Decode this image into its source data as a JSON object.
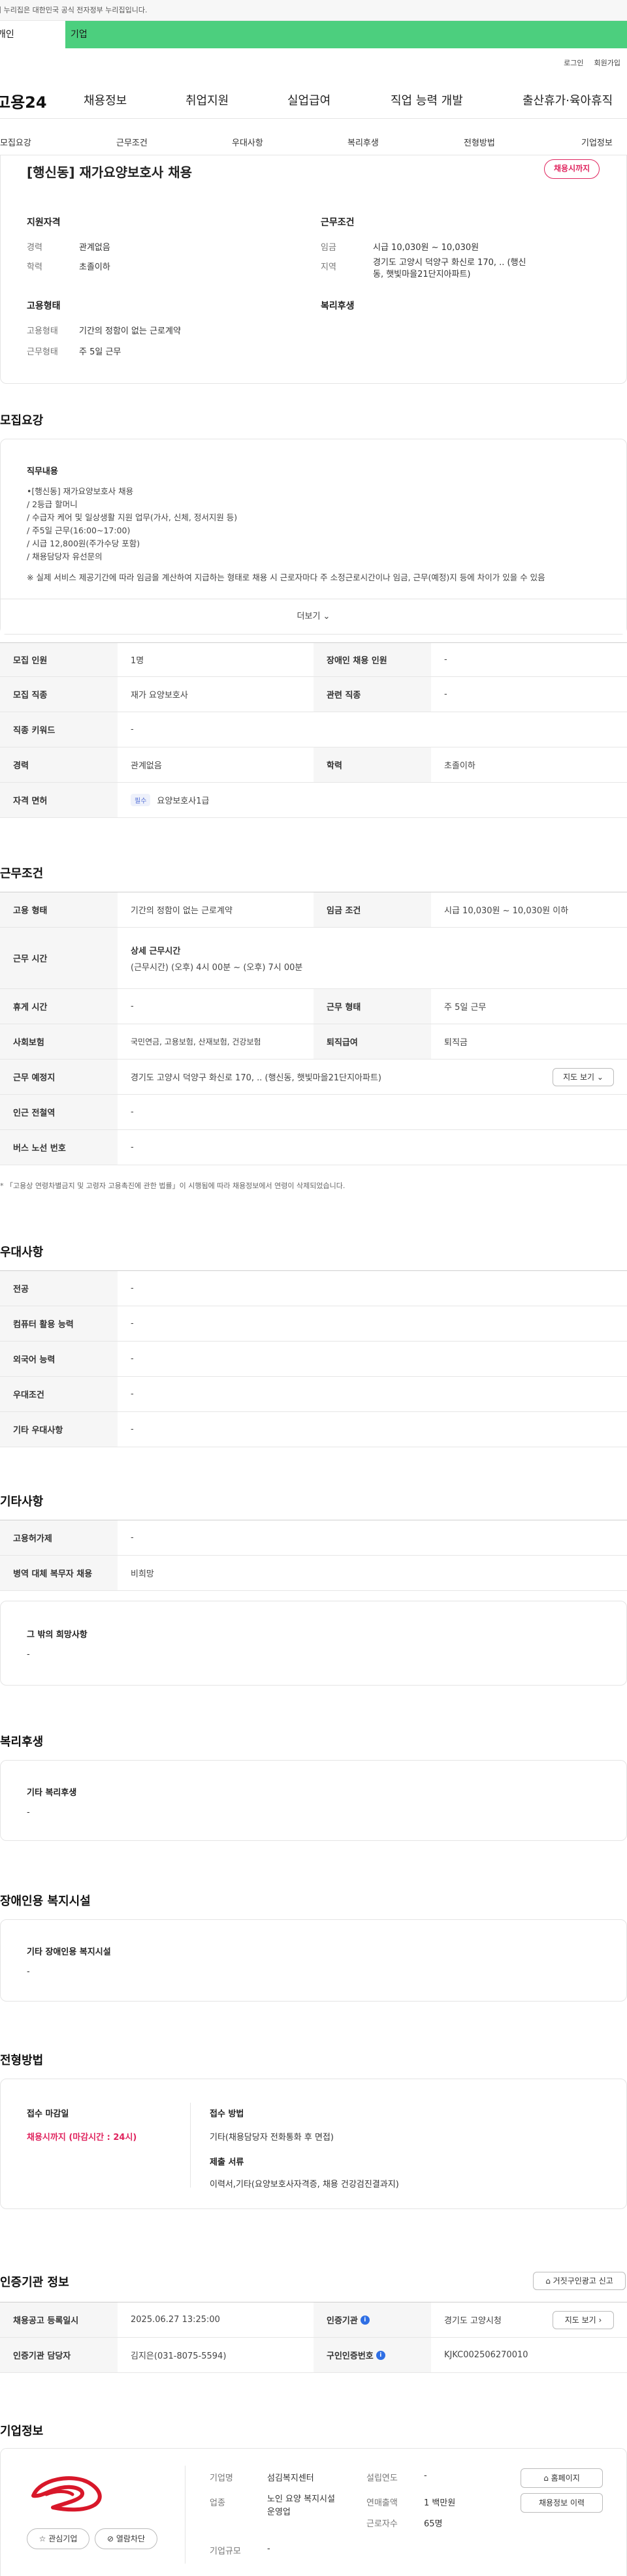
{
  "gov_banner": "이 누리집은 대한민국 공식 전자정부 누리집입니다.",
  "tabs": [
    "개인",
    "기업"
  ],
  "util": [
    "로그인",
    "회원가입"
  ],
  "logo": "고용24",
  "gnb": [
    "채용정보",
    "취업지원",
    "실업급여",
    "직업 능력 개발",
    "출산휴가·육아휴직"
  ],
  "subnav": [
    "모집요강",
    "근무조건",
    "우대사항",
    "복리후생",
    "전형방법",
    "기업정보"
  ],
  "job": {
    "title": "[행신동] 재가요양보호사 채용",
    "status": "채용시까지",
    "support_title": "지원자격",
    "support": [
      [
        "경력",
        "관계없음"
      ],
      [
        "학력",
        "초졸이하"
      ]
    ],
    "cond_title": "근무조건",
    "cond": [
      [
        "임금",
        "시급 10,030원 ~ 10,030원"
      ],
      [
        "지역",
        "경기도 고양시 덕양구 화신로 170, .. (행신동, 햇빛마을21단지아파트)"
      ]
    ],
    "emp_title": "고용형태",
    "emp": [
      [
        "고용형태",
        "기간의 정함이 없는 근로계약"
      ],
      [
        "근무형태",
        "주 5일 근무"
      ]
    ],
    "welfare_title": "복리후생"
  },
  "recruit": {
    "title": "모집요강",
    "duty_label": "직무내용",
    "duty_lines": [
      "•[행신동] 재가요양보호사 채용",
      "/ 2등급 할머니",
      "/ 수급자 케어 및 일상생활 지원 업무(가사, 신체, 정서지원 등)",
      "/ 주5일 근무(16:00~17:00)",
      "/ 시급 12,800원(주가수당 포함)",
      "/ 채용담당자 유선문의",
      "",
      "※ 실제 서비스 제공기간에 따라 임금을 계산하여 지급하는 형태로 채용 시 근로자마다 주 소정근로시간이나 임금, 근무(예정)지 등에 차이가 있을 수 있음"
    ],
    "more": "더보기",
    "rows": [
      [
        "모집 인원",
        "1명",
        "장애인 채용 인원",
        "-"
      ],
      [
        "모집 직종",
        "재가 요양보호사",
        "관련 직종",
        "-"
      ],
      [
        "직종 키워드",
        "-"
      ],
      [
        "경력",
        "관계없음",
        "학력",
        "초졸이하"
      ],
      [
        "자격 면허",
        "요양보호사1급"
      ]
    ],
    "license_tag": "필수"
  },
  "work": {
    "title": "근무조건",
    "emp_type_k": "고용 형태",
    "emp_type_v": "기간의 정함이 없는 근로계약",
    "wage_k": "임금 조건",
    "wage_v": "시급 10,030원 ~ 10,030원 이하",
    "hours_k": "근무 시간",
    "hours_title": "상세 근무시간",
    "hours_v": "(근무시간) (오후) 4시 00분 ~ (오후) 7시 00분",
    "break_k": "휴게 시간",
    "break_v": "-",
    "shift_k": "근무 형태",
    "shift_v": "주 5일 근무",
    "ins_k": "사회보험",
    "ins_v": "국민연금, 고용보험, 산재보험, 건강보험",
    "sev_k": "퇴직급여",
    "sev_v": "퇴직금",
    "place_k": "근무 예정지",
    "place_v": "경기도 고양시 덕양구 화신로 170, .. (행신동, 햇빛마을21단지아파트)",
    "map_btn": "지도 보기",
    "subway_k": "인근 전철역",
    "subway_v": "-",
    "bus_k": "버스 노선 번호",
    "bus_v": "-",
    "note": "* 「고용상 연령차별금지 및 고령자 고용촉진에 관한 법률」이 시행됨에 따라 채용정보에서 연령이 삭제되었습니다."
  },
  "pref": {
    "title": "우대사항",
    "rows": [
      [
        "전공",
        "-"
      ],
      [
        "컴퓨터 활용 능력",
        "-"
      ],
      [
        "외국어 능력",
        "-"
      ],
      [
        "우대조건",
        "-"
      ],
      [
        "기타 우대사항",
        "-"
      ]
    ]
  },
  "etc": {
    "title": "기타사항",
    "rows": [
      [
        "고용허가제",
        "-"
      ],
      [
        "병역 대체 복무자 채용",
        "비희망"
      ]
    ],
    "hope_label": "그 밖의 희망사항",
    "hope_v": "-"
  },
  "welfare": {
    "title": "복리후생",
    "label": "기타 복리후생",
    "v": "-"
  },
  "disabled": {
    "title": "장애인용 복지시설",
    "label": "기타 장애인용 복지시설",
    "v": "-"
  },
  "process": {
    "title": "전형방법",
    "deadline_label": "접수 마감일",
    "deadline_v": "채용시까지 (마감시간 : 24시)",
    "method_label": "접수 방법",
    "method_v": "기타(채용담당자 전화통화 후 면접)",
    "docs_label": "제출 서류",
    "docs_v": "이력서,기타(요양보호사자격증, 채용 건강검진결과지)"
  },
  "cert": {
    "title": "인증기관 정보",
    "report_btn": "거짓구인광고 신고",
    "reg_k": "채용공고 등록일시",
    "reg_v": "2025.06.27 13:25:00",
    "org_k": "인증기관",
    "org_v": "경기도 고양시청",
    "map_btn": "지도 보기",
    "mgr_k": "인증기관 담당자",
    "mgr_v": "김지은(031-8075-5594)",
    "id_k": "구인인증번호",
    "id_v": "KJKC002506270010"
  },
  "company": {
    "title": "기업정보",
    "fav_btn": "관심기업",
    "block_btn": "열람차단",
    "name_k": "기업명",
    "name_v": "섬김복지센터",
    "year_k": "설립연도",
    "year_v": "-",
    "ind_k": "업종",
    "ind_v": "노인 요양 복지시설 운영업",
    "sales_k": "연매출액",
    "sales_v": "1 백만원",
    "emp_k": "근로자수",
    "emp_v": "65명",
    "size_k": "기업규모",
    "size_v": "-",
    "home_btn": "홈페이지",
    "hist_btn": "채용정보 이력"
  }
}
